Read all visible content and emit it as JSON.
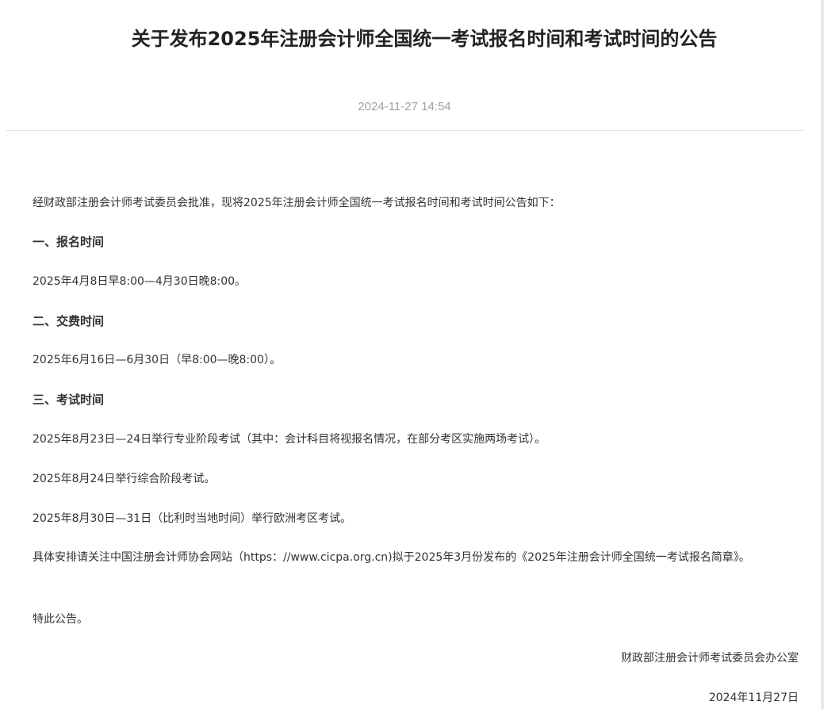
{
  "article": {
    "title": "关于发布2025年注册会计师全国统一考试报名时间和考试时间的公告",
    "date": "2024-11-27 14:54",
    "intro": "经财政部注册会计师考试委员会批准，现将2025年注册会计师全国统一考试报名时间和考试时间公告如下：",
    "sections": [
      {
        "heading": "一、报名时间",
        "lines": [
          "2025年4月8日早8:00—4月30日晚8:00。"
        ]
      },
      {
        "heading": "二、交费时间",
        "lines": [
          "2025年6月16日—6月30日（早8:00—晚8:00）。"
        ]
      },
      {
        "heading": "三、考试时间",
        "lines": [
          "2025年8月23日—24日举行专业阶段考试（其中：会计科目将视报名情况，在部分考区实施两场考试）。",
          "2025年8月24日举行综合阶段考试。",
          "2025年8月30日—31日（比利时当地时间）举行欧洲考区考试。"
        ]
      }
    ],
    "arrangement": "具体安排请关注中国注册会计师协会网站（https：//www.cicpa.org.cn)拟于2025年3月份发布的《2025年注册会计师全国统一考试报名简章》。",
    "closing": "特此公告。",
    "issuer": "财政部注册会计师考试委员会办公室",
    "issue_date": "2024年11月27日"
  }
}
